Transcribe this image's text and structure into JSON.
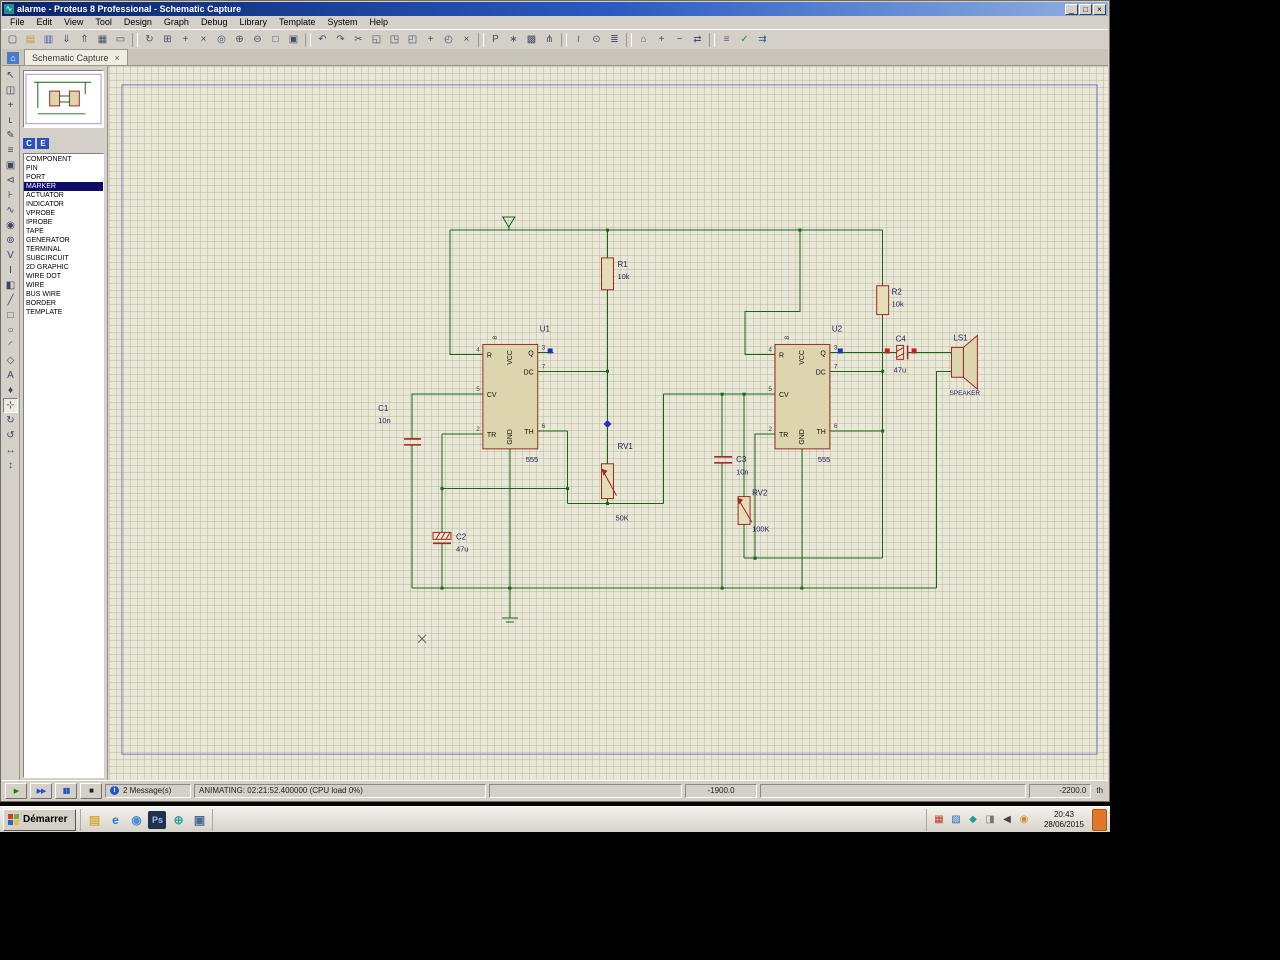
{
  "window": {
    "title": "alarme - Proteus 8 Professional - Schematic Capture",
    "app_icon_glyph": "∿",
    "controls": [
      {
        "name": "minimize-button",
        "glyph": "_"
      },
      {
        "name": "maximize-button",
        "glyph": "□"
      },
      {
        "name": "close-button",
        "glyph": "×"
      }
    ]
  },
  "menu": {
    "items": [
      {
        "name": "menu-file",
        "label": "File"
      },
      {
        "name": "menu-edit",
        "label": "Edit"
      },
      {
        "name": "menu-view",
        "label": "View"
      },
      {
        "name": "menu-tool",
        "label": "Tool"
      },
      {
        "name": "menu-design",
        "label": "Design"
      },
      {
        "name": "menu-graph",
        "label": "Graph"
      },
      {
        "name": "menu-debug",
        "label": "Debug"
      },
      {
        "name": "menu-library",
        "label": "Library"
      },
      {
        "name": "menu-template",
        "label": "Template"
      },
      {
        "name": "menu-system",
        "label": "System"
      },
      {
        "name": "menu-help",
        "label": "Help"
      }
    ]
  },
  "toolbar": {
    "icons": [
      {
        "name": "new-file-button",
        "glyph": "▢"
      },
      {
        "name": "open-file-button",
        "glyph": "▤",
        "color": "#c79a3a"
      },
      {
        "name": "save-file-button",
        "glyph": "▥",
        "color": "#3b5bbb"
      },
      {
        "name": "import-button",
        "glyph": "⇓"
      },
      {
        "name": "export-button",
        "glyph": "⇑"
      },
      {
        "name": "print-button",
        "glyph": "▦"
      },
      {
        "name": "mark-output-area-button",
        "glyph": "▭"
      },
      {
        "name": "separator",
        "sep": true
      },
      {
        "name": "redraw-button",
        "glyph": "↻"
      },
      {
        "name": "toggle-grid-button",
        "glyph": "⊞"
      },
      {
        "name": "toggle-origin-button",
        "glyph": "+"
      },
      {
        "name": "x-cursor-button",
        "glyph": "×"
      },
      {
        "name": "pan-button",
        "glyph": "◎"
      },
      {
        "name": "zoom-in-button",
        "glyph": "⊕"
      },
      {
        "name": "zoom-out-button",
        "glyph": "⊖"
      },
      {
        "name": "zoom-all-button",
        "glyph": "□"
      },
      {
        "name": "zoom-area-button",
        "glyph": "▣"
      },
      {
        "name": "separator",
        "sep": true
      },
      {
        "name": "undo-button",
        "glyph": "↶"
      },
      {
        "name": "redo-button",
        "glyph": "↷"
      },
      {
        "name": "cut-button",
        "glyph": "✂"
      },
      {
        "name": "copy-button",
        "glyph": "◱"
      },
      {
        "name": "paste-button",
        "glyph": "◳"
      },
      {
        "name": "block-copy-button",
        "glyph": "◰"
      },
      {
        "name": "block-move-button",
        "glyph": "+"
      },
      {
        "name": "block-rotate-button",
        "glyph": "◴"
      },
      {
        "name": "block-delete-button",
        "glyph": "×"
      },
      {
        "name": "separator",
        "sep": true
      },
      {
        "name": "pick-parts-button",
        "glyph": "P"
      },
      {
        "name": "make-device-button",
        "glyph": "∗"
      },
      {
        "name": "packaging-tool-button",
        "glyph": "▩"
      },
      {
        "name": "decompose-button",
        "glyph": "⋔"
      },
      {
        "name": "separator",
        "sep": true
      },
      {
        "name": "wire-autorouter-button",
        "glyph": "≀"
      },
      {
        "name": "search-button",
        "glyph": "⊙"
      },
      {
        "name": "property-assignment-button",
        "glyph": "≣"
      },
      {
        "name": "separator",
        "sep": true
      },
      {
        "name": "design-explorer-button",
        "glyph": "⌂",
        "color": "#2a7a7a"
      },
      {
        "name": "new-sheet-button",
        "glyph": "+"
      },
      {
        "name": "remove-sheet-button",
        "glyph": "−"
      },
      {
        "name": "goto-sheet-button",
        "glyph": "⇄"
      },
      {
        "name": "separator",
        "sep": true
      },
      {
        "name": "bom-button",
        "glyph": "≡",
        "color": "#7a4a9a"
      },
      {
        "name": "electrical-check-button",
        "glyph": "✓",
        "color": "#2a8a2a"
      },
      {
        "name": "netlist-button",
        "glyph": "⇉",
        "color": "#2a5aaa"
      }
    ]
  },
  "tabs": {
    "home_glyph": "⌂",
    "active_label": "Schematic Capture",
    "close_glyph": "×"
  },
  "modebar": {
    "icons": [
      {
        "name": "selection-mode",
        "glyph": "↖"
      },
      {
        "name": "component-mode",
        "glyph": "◫"
      },
      {
        "name": "junction-dot-mode",
        "glyph": "+"
      },
      {
        "name": "wire-label-mode",
        "glyph": "ʟ"
      },
      {
        "name": "text-script-mode",
        "glyph": "✎"
      },
      {
        "name": "buses-mode",
        "glyph": "≡"
      },
      {
        "name": "subcircuit-mode",
        "glyph": "▣"
      },
      {
        "name": "terminals-mode",
        "glyph": "⊲"
      },
      {
        "name": "device-pins-mode",
        "glyph": "⊦"
      },
      {
        "name": "graph-mode",
        "glyph": "∿"
      },
      {
        "name": "tape-recorder-mode",
        "glyph": "◉"
      },
      {
        "name": "generator-mode",
        "glyph": "⊚"
      },
      {
        "name": "voltage-probe-mode",
        "glyph": "V"
      },
      {
        "name": "current-probe-mode",
        "glyph": "I"
      },
      {
        "name": "virtual-instruments-mode",
        "glyph": "◧"
      },
      {
        "name": "2d-line-mode",
        "glyph": "╱"
      },
      {
        "name": "2d-box-mode",
        "glyph": "□"
      },
      {
        "name": "2d-circle-mode",
        "glyph": "○"
      },
      {
        "name": "2d-arc-mode",
        "glyph": "◜"
      },
      {
        "name": "2d-path-mode",
        "glyph": "◇"
      },
      {
        "name": "2d-text-mode",
        "glyph": "A"
      },
      {
        "name": "2d-symbol-mode",
        "glyph": "♦"
      },
      {
        "name": "2d-marker-mode",
        "glyph": "⊹",
        "pressed": true
      },
      {
        "name": "rotate-clockwise",
        "glyph": "↻"
      },
      {
        "name": "rotate-anticlockwise",
        "glyph": "↺"
      },
      {
        "name": "x-mirror",
        "glyph": "↔"
      },
      {
        "name": "y-mirror",
        "glyph": "↕"
      }
    ]
  },
  "selector": {
    "button_c": "C",
    "button_e": "E",
    "items": [
      {
        "name": "style-component",
        "label": "COMPONENT"
      },
      {
        "name": "style-pin",
        "label": "PIN"
      },
      {
        "name": "style-port",
        "label": "PORT"
      },
      {
        "name": "style-marker",
        "label": "MARKER",
        "selected": true
      },
      {
        "name": "style-actuator",
        "label": "ACTUATOR"
      },
      {
        "name": "style-indicator",
        "label": "INDICATOR"
      },
      {
        "name": "style-vprobe",
        "label": "VPROBE"
      },
      {
        "name": "style-iprobe",
        "label": "IPROBE"
      },
      {
        "name": "style-tape",
        "label": "TAPE"
      },
      {
        "name": "style-generator",
        "label": "GENERATOR"
      },
      {
        "name": "style-terminal",
        "label": "TERMINAL"
      },
      {
        "name": "style-subcircuit",
        "label": "SUBCIRCUIT"
      },
      {
        "name": "style-2d-graphic",
        "label": "2D GRAPHIC"
      },
      {
        "name": "style-wire-dot",
        "label": "WIRE DOT"
      },
      {
        "name": "style-wire",
        "label": "WIRE"
      },
      {
        "name": "style-bus-wire",
        "label": "BUS WIRE"
      },
      {
        "name": "style-border",
        "label": "BORDER"
      },
      {
        "name": "style-template",
        "label": "TEMPLATE"
      }
    ]
  },
  "schematic": {
    "u1": {
      "ref": "U1",
      "part": "555"
    },
    "u2": {
      "ref": "U2",
      "part": "555"
    },
    "r1": {
      "ref": "R1",
      "value": "10k"
    },
    "r2": {
      "ref": "R2",
      "value": "10k"
    },
    "rv1": {
      "ref": "RV1",
      "value": "50K"
    },
    "rv2": {
      "ref": "RV2",
      "value": "100K"
    },
    "c1": {
      "ref": "C1",
      "value": "10n"
    },
    "c2": {
      "ref": "C2",
      "value": "47u"
    },
    "c3": {
      "ref": "C3",
      "value": "10n"
    },
    "c4": {
      "ref": "C4",
      "value": "47u"
    },
    "ls1": {
      "ref": "LS1",
      "value": "SPEAKER"
    },
    "pins": {
      "r": "R",
      "cv": "CV",
      "tr": "TR",
      "q": "Q",
      "dc": "DC",
      "th": "TH",
      "vcc": "VCC",
      "gnd": "GND"
    },
    "pin_numbers": {
      "r": "4",
      "cv": "5",
      "tr": "2",
      "q": "3",
      "dc": "7",
      "th": "6",
      "vcc": "8"
    }
  },
  "statusbar": {
    "play_glyph": "▶",
    "step_glyph": "▶▶",
    "pause_glyph": "▮▮",
    "stop_glyph": "■",
    "message_icon_glyph": "i",
    "messages_label": "2 Message(s)",
    "animating_label": "ANIMATING: 02:21:52.400000 (CPU load 0%)",
    "coord_x": "-1900.0",
    "coord_y": "-2200.0",
    "coord_unit": "th"
  },
  "taskbar": {
    "start_label": "Démarrer",
    "clock_time": "20:43",
    "clock_date": "28/06/2015",
    "quicklaunch": [
      {
        "name": "explorer-icon",
        "glyph": "▤",
        "color": "#d8a838"
      },
      {
        "name": "internet-explorer-icon",
        "glyph": "e",
        "color": "#2f6fd0"
      },
      {
        "name": "chrome-icon",
        "glyph": "◉",
        "color": "#4a90d9"
      },
      {
        "name": "photoshop-icon",
        "glyph": "Ps",
        "color": "#9cc0e8",
        "bg": "#203050"
      },
      {
        "name": "browser-globe-icon",
        "glyph": "⊕",
        "color": "#3aa0a0"
      },
      {
        "name": "app-window-icon",
        "glyph": "▣",
        "color": "#4a6a9a"
      }
    ],
    "tray": [
      {
        "name": "tray-icon-1",
        "glyph": "▦",
        "color": "#c03a2a"
      },
      {
        "name": "tray-icon-2",
        "glyph": "▨",
        "color": "#2a6ac0"
      },
      {
        "name": "tray-icon-3",
        "glyph": "◆",
        "color": "#20a090"
      },
      {
        "name": "tray-icon-4",
        "glyph": "◨",
        "color": "#777777"
      },
      {
        "name": "volume-icon",
        "glyph": "◀",
        "color": "#444444"
      },
      {
        "name": "tray-icon-6",
        "glyph": "◉",
        "color": "#d08a28"
      }
    ]
  },
  "colors": {
    "titlebar_blue": "#0a246a",
    "canvas_background": "#e9e8d8",
    "grid_line": "#cfcdb4",
    "wire_green": "#176617",
    "component_outline": "#9c2b21",
    "component_fill": "#dcd5ae",
    "sheet_border_blue": "#7070c0",
    "selection_highlight": "#0c0c66",
    "state_high_blue": "#2233bb",
    "state_low_red": "#c22222"
  }
}
